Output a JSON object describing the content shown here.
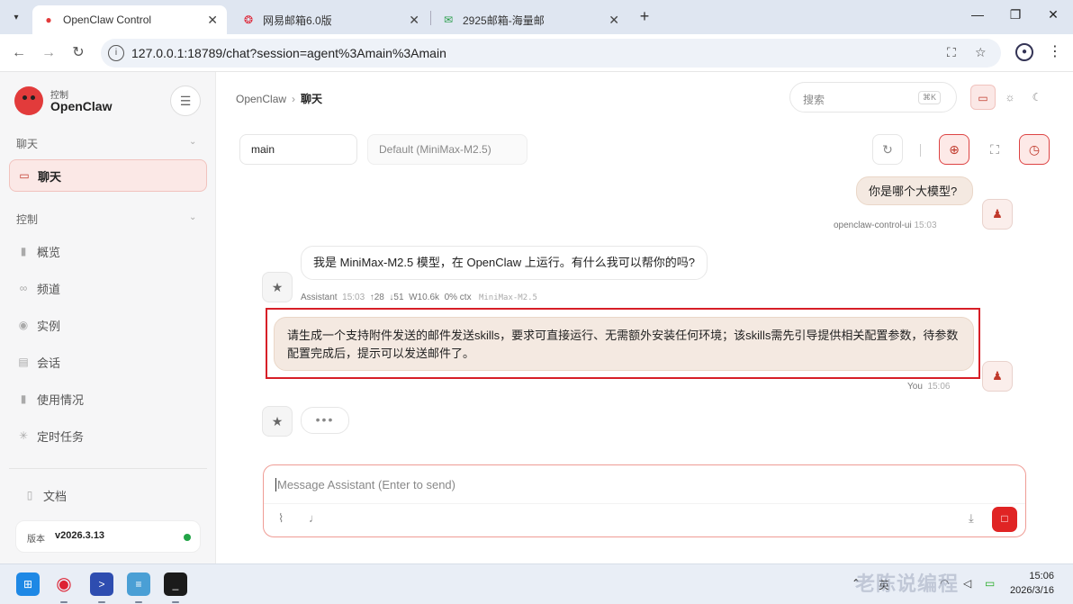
{
  "browser": {
    "tabs": [
      {
        "title": "OpenClaw Control",
        "favicon": "openclaw-crab-icon"
      },
      {
        "title": "网易邮箱6.0版",
        "favicon": "netease-mail-icon"
      },
      {
        "title": "2925邮箱-海量邮",
        "favicon": "mail-2925-icon"
      }
    ],
    "url": "127.0.0.1:18789/chat?session=agent%3Amain%3Amain"
  },
  "sidebar": {
    "brand_sub": "控制",
    "brand": "OpenClaw",
    "section_chat": "聊天",
    "chat_item": "聊天",
    "section_control": "控制",
    "control_items": [
      "概览",
      "频道",
      "实例",
      "会话",
      "使用情况",
      "定时任务"
    ],
    "docs": "文档",
    "version_label": "版本",
    "version_value": "v2026.3.13",
    "status_color": "#22a447"
  },
  "header": {
    "breadcrumb_root": "OpenClaw",
    "breadcrumb_current": "聊天",
    "search_placeholder": "搜索",
    "search_shortcut": "⌘K"
  },
  "chat": {
    "session": "main",
    "model": "Default (MiniMax-M2.5)",
    "messages": [
      {
        "role": "user",
        "text": "你是哪个大模型?",
        "sender": "openclaw-control-ui",
        "time": "15:03"
      },
      {
        "role": "assistant",
        "text": "我是 MiniMax-M2.5 模型，在 OpenClaw 上运行。有什么我可以帮你的吗?",
        "sender": "Assistant",
        "time": "15:03",
        "tokens_up": "↑28",
        "tokens_down": "↓51",
        "window": "W10.6k",
        "ctx": "0% ctx",
        "model": "MiniMax-M2.5"
      },
      {
        "role": "user",
        "text": "请生成一个支持附件发送的邮件发送skills，要求可直接运行、无需额外安装任何环境；该skills需先引导提供相关配置参数，待参数配置完成后，提示可以发送邮件了。",
        "sender": "You",
        "time": "15:06"
      }
    ],
    "composer_placeholder": "Message Assistant (Enter to send)",
    "accent_color": "#e02424"
  },
  "taskbar": {
    "clock_time": "15:06",
    "clock_date": "2026/3/16",
    "ime": "英"
  },
  "watermark": "老陈说编程"
}
